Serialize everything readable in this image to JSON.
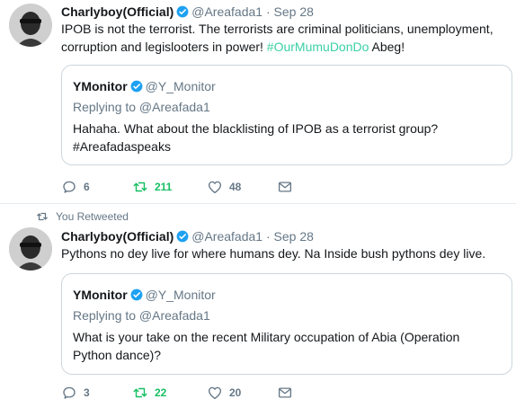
{
  "colors": {
    "link": "#3bd1a4",
    "retweet": "#17bf63",
    "muted": "#657786",
    "verified": "#1da1f2"
  },
  "tweets": [
    {
      "author_name": "Charlyboy(Official)",
      "author_handle": "@Areafada1",
      "separator": "·",
      "time": "Sep 28",
      "text_before": "IPOB is not the terrorist. The terrorists are criminal politicians, unemployment, corruption and legislooters in power! ",
      "hashtag": "#OurMumuDonDo",
      "text_after": " Abeg!",
      "quote": {
        "author_name": "YMonitor",
        "author_handle": "@Y_Monitor",
        "replying_to": "Replying to @Areafada1",
        "text_line1": "Hahaha. What about the blacklisting of IPOB as a terrorist group?",
        "text_line2": "#Areafadaspeaks"
      },
      "replies": "6",
      "retweets": "211",
      "likes": "48"
    },
    {
      "context": "You Retweeted",
      "author_name": "Charlyboy(Official)",
      "author_handle": "@Areafada1",
      "separator": "·",
      "time": "Sep 28",
      "text": "Pythons no dey live for where humans dey. Na Inside bush pythons dey live.",
      "quote": {
        "author_name": "YMonitor",
        "author_handle": "@Y_Monitor",
        "replying_to": "Replying to @Areafada1",
        "text_line1": "What is your take on the recent Military occupation of Abia (Operation",
        "text_line2": "Python dance)?"
      },
      "replies": "3",
      "retweets": "22",
      "likes": "20"
    }
  ]
}
